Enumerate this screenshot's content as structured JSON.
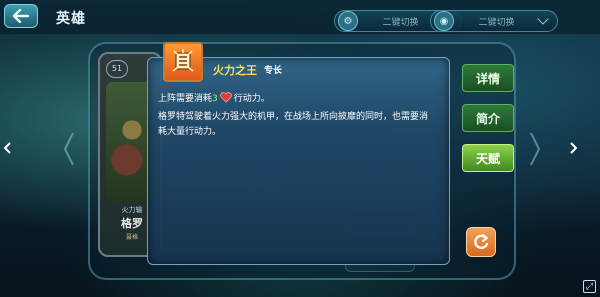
{
  "header": {
    "title": "英雄",
    "switch_left_label": "二键切换",
    "switch_right_label": "二键切换"
  },
  "hero_card": {
    "level": "51",
    "role": "火力输",
    "name": "格罗",
    "sub": "聂格"
  },
  "tabs": [
    {
      "label": "详情",
      "state": "normal"
    },
    {
      "label": "简介",
      "state": "normal"
    },
    {
      "label": "天赋",
      "state": "active"
    }
  ],
  "popup": {
    "skill_name": "火力之王",
    "skill_type": "专长",
    "line1_prefix": "上阵需要消耗",
    "line1_cost": "3",
    "line1_suffix": "行动力。",
    "line2": "格罗特驾驶着火力强大的机甲，在战场上所向披靡的同时，也需要消",
    "line3": "耗大量行动力。"
  },
  "colors": {
    "skill_name": "#ffe14a",
    "cost": "#7dff6e",
    "heart": "#e23a3a",
    "active_tab": "#6cbf35",
    "popup_bg": "#24506f"
  },
  "icons": {
    "back": "arrow-left-icon",
    "skill": "skill-firepower-icon",
    "refresh": "refresh-icon",
    "nav_left": "chevron-left-icon",
    "nav_right": "chevron-right-icon"
  }
}
